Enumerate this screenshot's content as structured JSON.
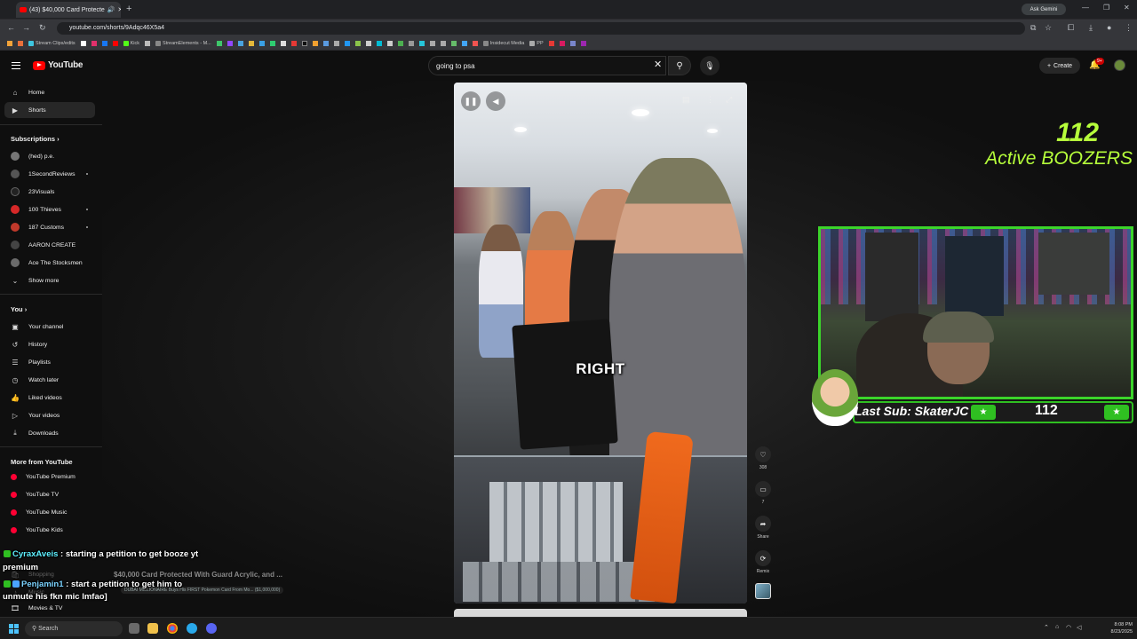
{
  "browser": {
    "tab_title": "(43) $40,000 Card Protecte",
    "url": "youtube.com/shorts/9Adqc46X5a4",
    "gemini_label": "Ask Gemini",
    "bookmarks": [
      "Stream Clips/edits",
      "Kick",
      "StreamElements - M...",
      "Insidecut Media",
      "PP"
    ]
  },
  "youtube": {
    "logo_text": "YouTube",
    "search_value": "going to psa",
    "create_label": "Create",
    "notif_badge": "9+",
    "sidebar": {
      "main": [
        {
          "label": "Home",
          "icon": "home-icon"
        },
        {
          "label": "Shorts",
          "icon": "shorts-icon"
        }
      ],
      "subscriptions_header": "Subscriptions",
      "subscriptions": [
        {
          "label": "(hed) p.e.",
          "color": "#777777"
        },
        {
          "label": "1SecondReviews",
          "color": "#555555"
        },
        {
          "label": "23Visuals",
          "color": "#222222"
        },
        {
          "label": "100 Thieves",
          "color": "#d62828"
        },
        {
          "label": "187 Customs",
          "color": "#c0392b"
        },
        {
          "label": "AARON CREATE",
          "color": "#444444"
        },
        {
          "label": "Ace The Stocksmen",
          "color": "#6b6b6b"
        }
      ],
      "show_more": "Show more",
      "you_header": "You",
      "you_items": [
        {
          "label": "Your channel",
          "icon": "channel-icon"
        },
        {
          "label": "History",
          "icon": "history-icon"
        },
        {
          "label": "Playlists",
          "icon": "playlists-icon"
        },
        {
          "label": "Watch later",
          "icon": "clock-icon"
        },
        {
          "label": "Liked videos",
          "icon": "thumb-up-icon"
        },
        {
          "label": "Your videos",
          "icon": "video-icon"
        },
        {
          "label": "Downloads",
          "icon": "download-icon"
        }
      ],
      "more_header": "More from YouTube",
      "more_items": [
        {
          "label": "YouTube Premium"
        },
        {
          "label": "YouTube TV"
        },
        {
          "label": "YouTube Music"
        },
        {
          "label": "YouTube Kids"
        }
      ],
      "bottom_items": [
        {
          "label": "Shopping"
        },
        {
          "label": "Music"
        },
        {
          "label": "Movies & TV"
        }
      ]
    },
    "short": {
      "caption": "RIGHT",
      "like_count": "308",
      "comment_count": "7",
      "share_label": "Share",
      "remix_label": "Remix",
      "below_title": "$40,000 Card Protected With Guard Acrylic, and ...",
      "below_sub": "DUBAI MILLIONAIRE Buys His FIRST Pokemon Card From Mo... ($1,000,000)"
    }
  },
  "stream_overlay": {
    "active_count": "112",
    "active_label": "Active BOOZERS",
    "last_sub_label": "Last Sub: SkaterJC",
    "sub_count": "112",
    "chat": [
      {
        "user": "CyraxAveis",
        "message": ": starting a petition to get booze yt",
        "cont": "premium"
      },
      {
        "user": "Penjamin1",
        "message": ": start a petition to get him to",
        "cont": "unmute his fkn mic lmfao]"
      }
    ]
  },
  "taskbar": {
    "search_label": "Search",
    "time": "8:08 PM",
    "date": "8/23/2025"
  }
}
